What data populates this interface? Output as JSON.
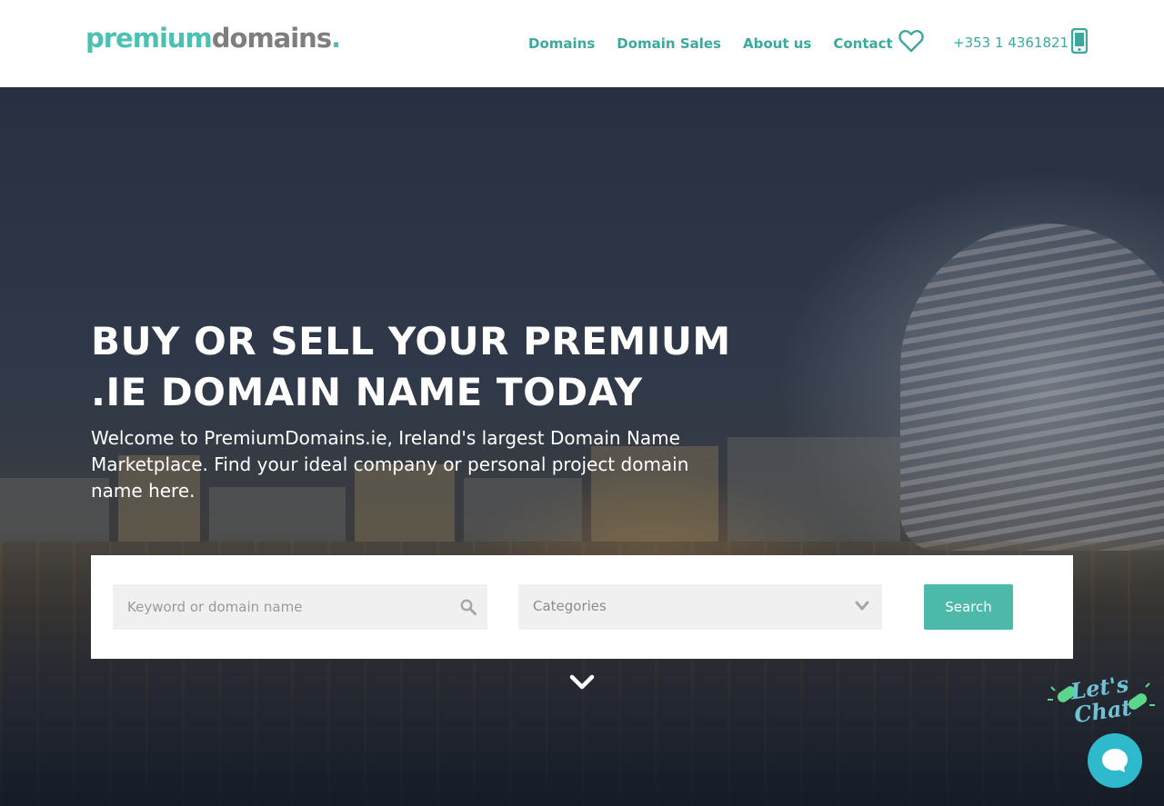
{
  "header": {
    "logo": {
      "part1": "premium",
      "part2": "domains",
      "part3": "."
    },
    "nav": [
      "Domains",
      "Domain Sales",
      "About us",
      "Contact"
    ],
    "favorites_icon": "heart-icon",
    "phone": "+353 1 4361821",
    "phone_icon": "mobile-phone-icon"
  },
  "hero": {
    "title": "BUY OR SELL YOUR PREMIUM .IE DOMAIN NAME TODAY",
    "subtitle": "Welcome to PremiumDomains.ie, Ireland's largest Domain Name Marketplace. Find your ideal company or personal project domain name here."
  },
  "search": {
    "keyword_placeholder": "Keyword or domain name",
    "categories_label": "Categories",
    "button_label": "Search"
  },
  "chat": {
    "bubble_text": "Let's Chat",
    "icon": "chat-bubble-icon"
  },
  "colors": {
    "brand_teal": "#4cc1b3",
    "nav_teal": "#3ba99d",
    "logo_grey": "#7e7e7e",
    "button_teal": "#4cb9ab",
    "chat_blue": "#2fb9cc"
  }
}
